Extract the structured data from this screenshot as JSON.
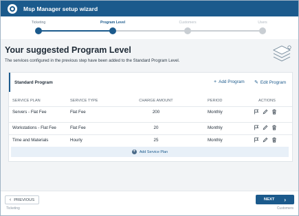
{
  "window": {
    "title": "Msp Manager setup wizard"
  },
  "steps": [
    {
      "label": "Ticketing",
      "state": "done"
    },
    {
      "label": "Program Level",
      "state": "current"
    },
    {
      "label": "Customers",
      "state": "todo"
    },
    {
      "label": "Users",
      "state": "todo"
    }
  ],
  "colors": {
    "primary": "#1b5a8c",
    "inactive": "#c9ced3",
    "background": "#f2f4f6"
  },
  "header": {
    "title": "Your suggested Program Level",
    "subtitle": "The services configured in the previous step have been added to the Standard Program Level."
  },
  "card": {
    "title": "Standard Program",
    "add_label": "Add Program",
    "edit_label": "Edit Program",
    "columns": [
      "SERVICE PLAN",
      "SERVICE TYPE",
      "CHARGE AMOUNT",
      "PERIOD",
      "ACTIONS"
    ],
    "rows": [
      {
        "plan": "Servers - Flat Fee",
        "type": "Flat Fee",
        "amount": "200",
        "period": "Monthly"
      },
      {
        "plan": "Workstations - Flat Fee",
        "type": "Flat Fee",
        "amount": "20",
        "period": "Monthly"
      },
      {
        "plan": "Time and Materials",
        "type": "Hourly",
        "amount": "25",
        "period": "Monthly"
      }
    ],
    "row_action_icons": [
      "flag-icon",
      "pencil-icon",
      "trash-icon"
    ],
    "add_service_label": "Add Service Plan"
  },
  "footer": {
    "prev_label": "PREVIOUS",
    "next_label": "NEXT",
    "prev_step": "Ticketing",
    "next_step": "Customers"
  }
}
